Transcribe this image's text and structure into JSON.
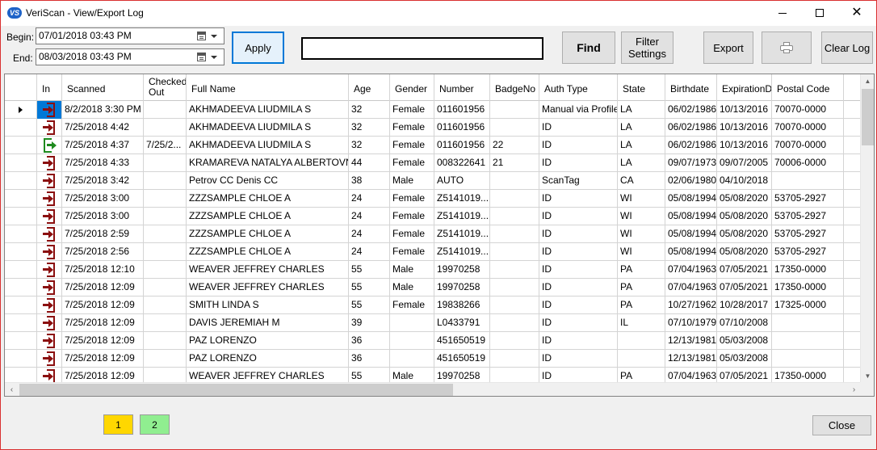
{
  "window": {
    "title": "VeriScan - View/Export Log",
    "logo_text": "VS"
  },
  "filters": {
    "begin_label": "Begin:",
    "begin_value": "07/01/2018 03:43 PM",
    "end_label": "End:",
    "end_value": "08/03/2018 03:43 PM",
    "search_value": ""
  },
  "toolbar": {
    "apply_label": "Apply",
    "find_label": "Find",
    "filter_settings_label": "Filter Settings",
    "export_label": "Export",
    "print_icon": "printer-icon",
    "clear_log_label": "Clear Log"
  },
  "columns": [
    "In",
    "Scanned",
    "Checked Out",
    "Full Name",
    "Age",
    "Gender",
    "Number",
    "BadgeNo",
    "Auth Type",
    "State",
    "Birthdate",
    "ExpirationDate",
    "Postal Code"
  ],
  "rows": [
    {
      "in": "in",
      "scanned": "8/2/2018 3:30 PM",
      "checked_out": "",
      "full_name": "AKHMADEEVA LIUDMILA S",
      "age": "32",
      "gender": "Female",
      "number": "011601956",
      "badge": "",
      "auth_type": "Manual via Profile",
      "state": "LA",
      "birthdate": "06/02/1986",
      "expiration": "10/13/2016",
      "postal": "70070-0000"
    },
    {
      "in": "in",
      "scanned": "7/25/2018 4:42",
      "checked_out": "",
      "full_name": "AKHMADEEVA LIUDMILA S",
      "age": "32",
      "gender": "Female",
      "number": "011601956",
      "badge": "",
      "auth_type": "ID",
      "state": "LA",
      "birthdate": "06/02/1986",
      "expiration": "10/13/2016",
      "postal": "70070-0000"
    },
    {
      "in": "out",
      "scanned": "7/25/2018 4:37",
      "checked_out": "7/25/2...",
      "full_name": "AKHMADEEVA LIUDMILA S",
      "age": "32",
      "gender": "Female",
      "number": "011601956",
      "badge": "22",
      "auth_type": "ID",
      "state": "LA",
      "birthdate": "06/02/1986",
      "expiration": "10/13/2016",
      "postal": "70070-0000"
    },
    {
      "in": "in",
      "scanned": "7/25/2018 4:33",
      "checked_out": "",
      "full_name": "KRAMAREVA NATALYA ALBERTOVNA",
      "age": "44",
      "gender": "Female",
      "number": "008322641",
      "badge": "21",
      "auth_type": "ID",
      "state": "LA",
      "birthdate": "09/07/1973",
      "expiration": "09/07/2005",
      "postal": "70006-0000"
    },
    {
      "in": "in",
      "scanned": "7/25/2018 3:42",
      "checked_out": "",
      "full_name": "Petrov CC Denis CC",
      "age": "38",
      "gender": "Male",
      "number": "AUTO",
      "badge": "",
      "auth_type": "ScanTag",
      "state": "CA",
      "birthdate": "02/06/1980",
      "expiration": "04/10/2018",
      "postal": ""
    },
    {
      "in": "in",
      "scanned": "7/25/2018 3:00",
      "checked_out": "",
      "full_name": "ZZZSAMPLE CHLOE A",
      "age": "24",
      "gender": "Female",
      "number": "Z5141019...",
      "badge": "",
      "auth_type": "ID",
      "state": "WI",
      "birthdate": "05/08/1994",
      "expiration": "05/08/2020",
      "postal": "53705-2927"
    },
    {
      "in": "in",
      "scanned": "7/25/2018 3:00",
      "checked_out": "",
      "full_name": "ZZZSAMPLE CHLOE A",
      "age": "24",
      "gender": "Female",
      "number": "Z5141019...",
      "badge": "",
      "auth_type": "ID",
      "state": "WI",
      "birthdate": "05/08/1994",
      "expiration": "05/08/2020",
      "postal": "53705-2927"
    },
    {
      "in": "in",
      "scanned": "7/25/2018 2:59",
      "checked_out": "",
      "full_name": "ZZZSAMPLE CHLOE A",
      "age": "24",
      "gender": "Female",
      "number": "Z5141019...",
      "badge": "",
      "auth_type": "ID",
      "state": "WI",
      "birthdate": "05/08/1994",
      "expiration": "05/08/2020",
      "postal": "53705-2927"
    },
    {
      "in": "in",
      "scanned": "7/25/2018 2:56",
      "checked_out": "",
      "full_name": "ZZZSAMPLE CHLOE A",
      "age": "24",
      "gender": "Female",
      "number": "Z5141019...",
      "badge": "",
      "auth_type": "ID",
      "state": "WI",
      "birthdate": "05/08/1994",
      "expiration": "05/08/2020",
      "postal": "53705-2927"
    },
    {
      "in": "in",
      "scanned": "7/25/2018 12:10",
      "checked_out": "",
      "full_name": "WEAVER JEFFREY CHARLES",
      "age": "55",
      "gender": "Male",
      "number": "19970258",
      "badge": "",
      "auth_type": "ID",
      "state": "PA",
      "birthdate": "07/04/1963",
      "expiration": "07/05/2021",
      "postal": "17350-0000"
    },
    {
      "in": "in",
      "scanned": "7/25/2018 12:09",
      "checked_out": "",
      "full_name": "WEAVER JEFFREY CHARLES",
      "age": "55",
      "gender": "Male",
      "number": "19970258",
      "badge": "",
      "auth_type": "ID",
      "state": "PA",
      "birthdate": "07/04/1963",
      "expiration": "07/05/2021",
      "postal": "17350-0000"
    },
    {
      "in": "in",
      "scanned": "7/25/2018 12:09",
      "checked_out": "",
      "full_name": "SMITH LINDA S",
      "age": "55",
      "gender": "Female",
      "number": "19838266",
      "badge": "",
      "auth_type": "ID",
      "state": "PA",
      "birthdate": "10/27/1962",
      "expiration": "10/28/2017",
      "postal": "17325-0000"
    },
    {
      "in": "in",
      "scanned": "7/25/2018 12:09",
      "checked_out": "",
      "full_name": "DAVIS JEREMIAH M",
      "age": "39",
      "gender": "",
      "number": "L0433791",
      "badge": "",
      "auth_type": "ID",
      "state": "IL",
      "birthdate": "07/10/1979",
      "expiration": "07/10/2008",
      "postal": ""
    },
    {
      "in": "in",
      "scanned": "7/25/2018 12:09",
      "checked_out": "",
      "full_name": "PAZ LORENZO",
      "age": "36",
      "gender": "",
      "number": "451650519",
      "badge": "",
      "auth_type": "ID",
      "state": "",
      "birthdate": "12/13/1981",
      "expiration": "05/03/2008",
      "postal": ""
    },
    {
      "in": "in",
      "scanned": "7/25/2018 12:09",
      "checked_out": "",
      "full_name": "PAZ LORENZO",
      "age": "36",
      "gender": "",
      "number": "451650519",
      "badge": "",
      "auth_type": "ID",
      "state": "",
      "birthdate": "12/13/1981",
      "expiration": "05/03/2008",
      "postal": ""
    },
    {
      "in": "in",
      "scanned": "7/25/2018 12:09",
      "checked_out": "",
      "full_name": "WEAVER JEFFREY CHARLES",
      "age": "55",
      "gender": "Male",
      "number": "19970258",
      "badge": "",
      "auth_type": "ID",
      "state": "PA",
      "birthdate": "07/04/1963",
      "expiration": "07/05/2021",
      "postal": "17350-0000"
    }
  ],
  "pagination": {
    "pages": [
      {
        "label": "1",
        "color": "#ffd700"
      },
      {
        "label": "2",
        "color": "#90ee90"
      }
    ]
  },
  "footer": {
    "close_label": "Close"
  },
  "colors": {
    "accent": "#0078d7",
    "check_in_icon": "#8b0f0f",
    "check_out_icon": "#1e8a1e",
    "window_border": "#d93030"
  }
}
